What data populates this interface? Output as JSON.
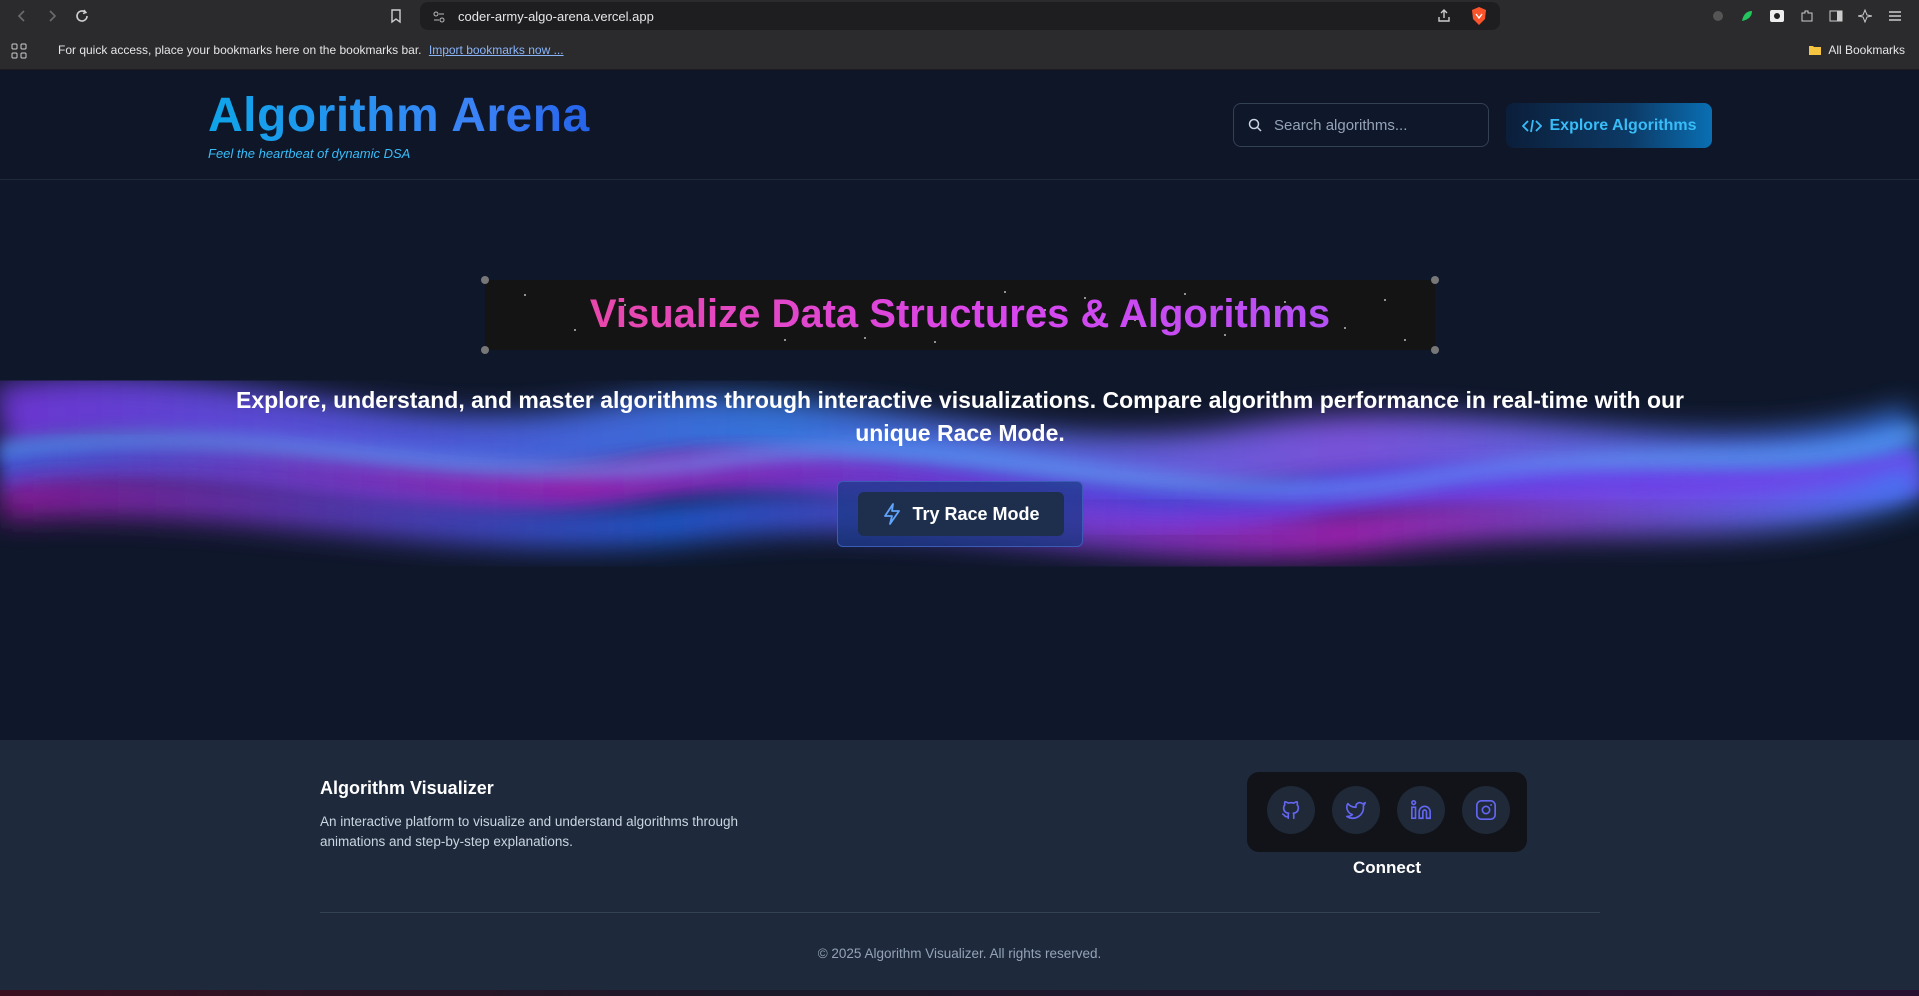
{
  "browser": {
    "url": "coder-army-algo-arena.vercel.app",
    "bookmarks_message": "For quick access, place your bookmarks here on the bookmarks bar.",
    "import_link": "Import bookmarks now ...",
    "all_bookmarks": "All Bookmarks"
  },
  "header": {
    "title": "Algorithm Arena",
    "subtitle": "Feel the heartbeat of dynamic DSA",
    "search_placeholder": "Search algorithms...",
    "explore_label": "Explore Algorithms"
  },
  "hero": {
    "title": "Visualize Data Structures & Algorithms",
    "description": "Explore, understand, and master algorithms through interactive visualizations. Compare algorithm performance in real-time with our unique Race Mode.",
    "race_label": "Try Race Mode"
  },
  "footer": {
    "title": "Algorithm Visualizer",
    "description": "An interactive platform to visualize and understand algorithms through animations and step-by-step explanations.",
    "connect_label": "Connect",
    "copyright": "© 2025 Algorithm Visualizer. All rights reserved.",
    "social_icons": [
      "github-icon",
      "twitter-icon",
      "linkedin-icon",
      "instagram-icon"
    ]
  },
  "colors": {
    "page_bg": "#0f172a",
    "footer_bg": "#1e293b",
    "accent_blue": "#3b82f6",
    "accent_pink": "#ec4899",
    "accent_purple": "#a855f7",
    "social_icon": "#6366f1"
  }
}
